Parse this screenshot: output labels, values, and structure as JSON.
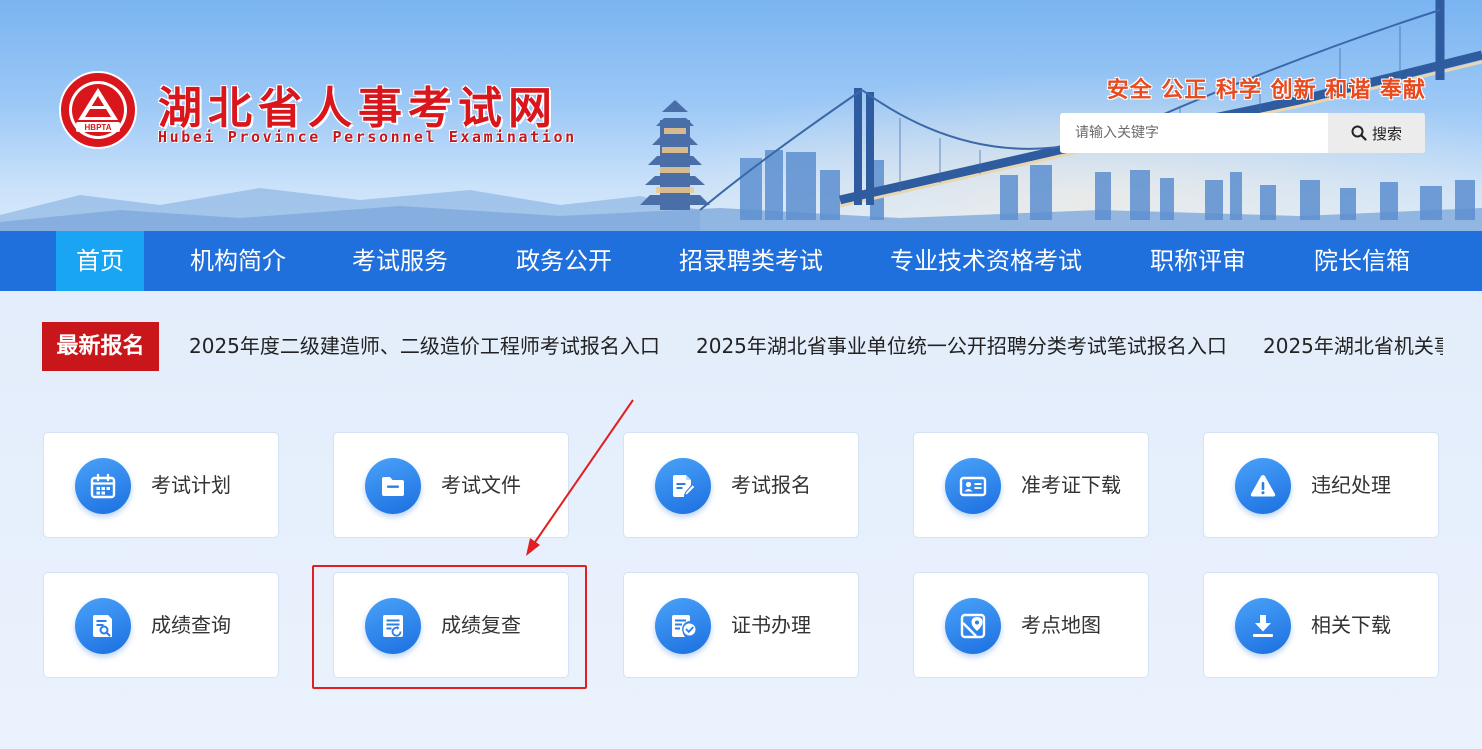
{
  "header": {
    "site_name_cn": "湖北省人事考试网",
    "site_name_en": "Hubei Province Personnel Examination",
    "emblem_text": "HBPTA",
    "slogan": "安全 公正 科学 创新 和谐 奉献",
    "search": {
      "placeholder": "请输入关键字",
      "button_label": "搜索",
      "value": ""
    }
  },
  "nav": {
    "items": [
      {
        "label": "首页",
        "active": true
      },
      {
        "label": "机构简介"
      },
      {
        "label": "考试服务"
      },
      {
        "label": "政务公开"
      },
      {
        "label": "招录聘类考试"
      },
      {
        "label": "专业技术资格考试"
      },
      {
        "label": "职称评审"
      },
      {
        "label": "院长信箱"
      }
    ]
  },
  "news": {
    "tag": "最新报名",
    "items": [
      "2025年度二级建造师、二级造价工程师考试报名入口",
      "2025年湖北省事业单位统一公开招聘分类考试笔试报名入口",
      "2025年湖北省机关事"
    ]
  },
  "services": {
    "tiles": [
      {
        "label": "考试计划",
        "icon": "calendar-icon"
      },
      {
        "label": "考试文件",
        "icon": "folder-icon"
      },
      {
        "label": "考试报名",
        "icon": "document-pen-icon"
      },
      {
        "label": "准考证下载",
        "icon": "id-card-icon"
      },
      {
        "label": "违纪处理",
        "icon": "warning-icon"
      },
      {
        "label": "成绩查询",
        "icon": "document-search-icon"
      },
      {
        "label": "成绩复查",
        "icon": "document-refresh-icon",
        "highlighted": true
      },
      {
        "label": "证书办理",
        "icon": "certificate-check-icon"
      },
      {
        "label": "考点地图",
        "icon": "map-pin-icon"
      },
      {
        "label": "相关下载",
        "icon": "download-icon"
      }
    ]
  },
  "colors": {
    "brand_red": "#c8161b",
    "nav_blue": "#1f6fdc",
    "nav_active": "#1aa4f4",
    "slogan_orange": "#e8491d",
    "icon_blue": "#1c6fe0",
    "annotation_red": "#e02020"
  }
}
